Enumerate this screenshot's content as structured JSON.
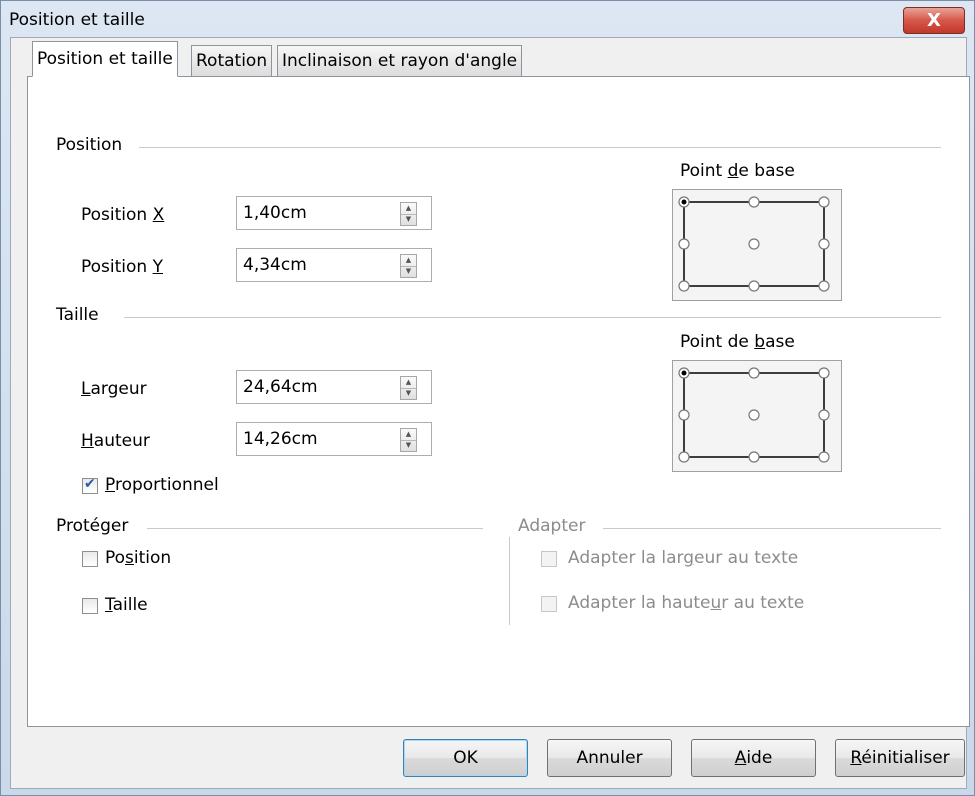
{
  "window": {
    "title": "Position et taille",
    "close_label": "X"
  },
  "tabs": [
    {
      "label": "Position et taille",
      "active": true
    },
    {
      "label": "Rotation",
      "active": false
    },
    {
      "label": "Inclinaison et rayon d'angle",
      "active": false
    }
  ],
  "position": {
    "section_label": "Position",
    "x_label": "Position X",
    "x_value": "1,40cm",
    "y_label": "Position Y",
    "y_value": "4,34cm",
    "base_point_label": "Point de base",
    "base_point_selected": "top-left"
  },
  "size": {
    "section_label": "Taille",
    "width_label": "Largeur",
    "width_value": "24,64cm",
    "height_label": "Hauteur",
    "height_value": "14,26cm",
    "proportional_label": "Proportionnel",
    "proportional_checked": true,
    "base_point_label": "Point de base",
    "base_point_selected": "top-left"
  },
  "protect": {
    "section_label": "Protéger",
    "position_label": "Position",
    "position_checked": false,
    "size_label": "Taille",
    "size_checked": false
  },
  "adapt": {
    "section_label": "Adapter",
    "fit_width_label": "Adapter la largeur au texte",
    "fit_height_label": "Adapter la hauteur au texte",
    "enabled": false
  },
  "buttons": {
    "ok": "OK",
    "cancel": "Annuler",
    "help": "Aide",
    "reset": "Réinitialiser"
  }
}
